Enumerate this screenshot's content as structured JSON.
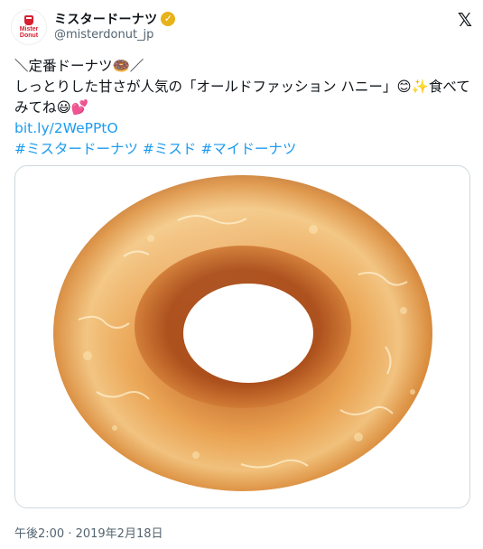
{
  "author": {
    "display_name": "ミスタードーナツ",
    "handle": "@misterdonut_jp",
    "avatar_text": "Mister Donut",
    "verified": true
  },
  "tweet": {
    "line1": "＼定番ドーナツ🍩／",
    "line2": "しっとりした甘さが人気の「オールドファッション ハニー」😊✨食べて",
    "line3": "みてね😃💕",
    "link": "bit.ly/2WePPtO",
    "hashtags": "#ミスタードーナツ #ミスド #マイドーナツ"
  },
  "media": {
    "icon": "old-fashioned-honey-donut"
  },
  "timestamp": "午後2:00 · 2019年2月18日",
  "colors": {
    "link": "#1d9bf0",
    "brand": "#d6202f",
    "verified": "#e8b21a"
  }
}
